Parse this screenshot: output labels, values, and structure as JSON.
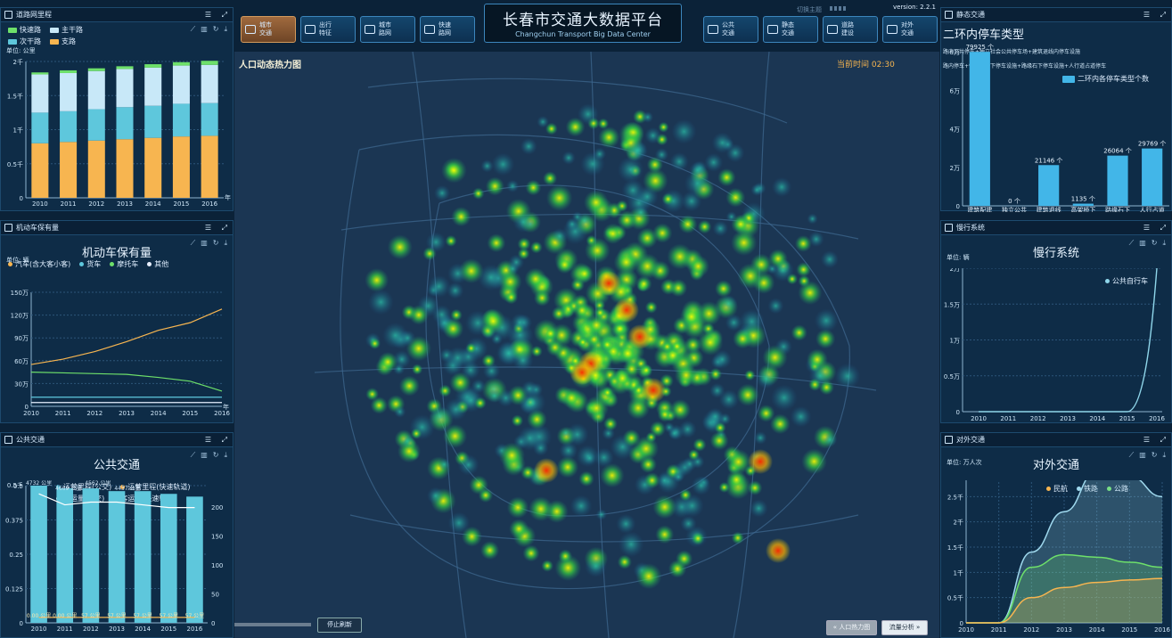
{
  "header": {
    "title": "长春市交通大数据平台",
    "subtitle": "Changchun Transport Big Data Center",
    "version": "version: 2.2.1",
    "theme_switch": "切换主题",
    "nav_left": [
      {
        "label1": "城市",
        "label2": "交通",
        "icon": "city-icon"
      },
      {
        "label1": "出行",
        "label2": "特征",
        "icon": "chart-icon"
      },
      {
        "label1": "城市",
        "label2": "路网",
        "icon": "road-icon"
      },
      {
        "label1": "快速",
        "label2": "路网",
        "icon": "car-icon"
      }
    ],
    "nav_right": [
      {
        "label1": "公共",
        "label2": "交通",
        "icon": "bus-icon"
      },
      {
        "label1": "静态",
        "label2": "交通",
        "icon": "map-icon"
      },
      {
        "label1": "道路",
        "label2": "建设",
        "icon": "build-icon"
      },
      {
        "label1": "对外",
        "label2": "交通",
        "icon": "external-icon"
      }
    ]
  },
  "map": {
    "title": "人口动态热力图",
    "time_label": "当前时间 02:30",
    "stop_button": "停止刷新",
    "tab_heatmap": "« 人口热力图",
    "tab_flow": "流量分析 »"
  },
  "colors": {
    "accent": "#f7b550",
    "panel_bg": "#0e2c47",
    "border": "#1d4a6e",
    "active_nav": "#a06a3e"
  },
  "road_panel": {
    "header": "道路网里程",
    "unit": "单位: 公里",
    "legend": [
      {
        "name": "快速路",
        "color": "#6ee06a"
      },
      {
        "name": "主干路",
        "color": "#c8e8f8"
      },
      {
        "name": "次干路",
        "color": "#5ec7dc"
      },
      {
        "name": "支路",
        "color": "#f7b550"
      }
    ],
    "chart_data": {
      "type": "bar",
      "categories": [
        "2010",
        "2011",
        "2012",
        "2013",
        "2014",
        "2015",
        "2016"
      ],
      "series": [
        {
          "name": "支路",
          "values": [
            800,
            820,
            840,
            860,
            880,
            900,
            910
          ]
        },
        {
          "name": "次干路",
          "values": [
            450,
            450,
            460,
            470,
            470,
            480,
            480
          ]
        },
        {
          "name": "主干路",
          "values": [
            560,
            560,
            560,
            560,
            560,
            560,
            560
          ]
        },
        {
          "name": "快速路",
          "values": [
            30,
            40,
            40,
            40,
            50,
            50,
            60
          ]
        }
      ],
      "yticks": [
        "0",
        "0.5千",
        "1千",
        "1.5千",
        "2千"
      ],
      "ylim": [
        0,
        2000
      ],
      "x_unit": "年"
    }
  },
  "vehicle_panel": {
    "header": "机动车保有量",
    "title": "机动车保有量",
    "unit": "单位: 辆",
    "legend": [
      {
        "name": "汽车(含大客小客)",
        "color": "#f7b550"
      },
      {
        "name": "货车",
        "color": "#5ec7dc"
      },
      {
        "name": "摩托车",
        "color": "#6ee06a"
      },
      {
        "name": "其他",
        "color": "#e8f0ff"
      }
    ],
    "chart_data": {
      "type": "line",
      "x": [
        "2010",
        "2011",
        "2012",
        "2013",
        "2014",
        "2015",
        "2016"
      ],
      "series": [
        {
          "name": "汽车(含大客小客)",
          "values": [
            55,
            62,
            72,
            85,
            100,
            110,
            128
          ]
        },
        {
          "name": "货车",
          "values": [
            12,
            12,
            12,
            12,
            12,
            12,
            12
          ]
        },
        {
          "name": "摩托车",
          "values": [
            45,
            44,
            43,
            42,
            38,
            33,
            20
          ]
        },
        {
          "name": "其他",
          "values": [
            5,
            5,
            5,
            5,
            5,
            5,
            5
          ]
        }
      ],
      "yticks": [
        "0",
        "30万",
        "60万",
        "90万",
        "120万",
        "150万"
      ],
      "ylim": [
        0,
        150
      ],
      "x_unit": "年"
    }
  },
  "transit_panel": {
    "header": "公共交通",
    "title": "公共交通",
    "legend": [
      {
        "name": "运营里程(公交)",
        "color": "#5ec7dc"
      },
      {
        "name": "运营里程(快速轨道)",
        "color": "#f7b550"
      },
      {
        "name": "客运量(公交)",
        "color": "#ffffff"
      },
      {
        "name": "客运量(快速轨道)",
        "color": "#6ee06a"
      }
    ],
    "chart_data": {
      "type": "bar",
      "categories": [
        "2010",
        "2011",
        "2012",
        "2013",
        "2014",
        "2015",
        "2016"
      ],
      "bars": [
        0.5,
        0.49,
        0.49,
        0.48,
        0.48,
        0.47,
        0.46
      ],
      "bus_passenger_line": [
        0.47,
        0.43,
        0.44,
        0.44,
        0.43,
        0.42,
        0.42
      ],
      "rail_passenger_line": [
        0.02,
        0.02,
        0.02,
        0.02,
        0.02,
        0.02,
        0.02
      ],
      "top_labels": [
        "4732 公里",
        "4669 公里",
        "4562 公里",
        "4437 公里"
      ],
      "bottom_labels": [
        "0.00 公里",
        "0.00 公里",
        "57 公里",
        "57 公里",
        "57 公里",
        "57 公里",
        "57 公里"
      ],
      "yticks_left": [
        "0",
        "0.125",
        "0.25",
        "0.375",
        "0.5",
        "0.5千"
      ],
      "yticks_right": [
        "0",
        "50",
        "100",
        "150",
        "200"
      ],
      "ylim": [
        0,
        0.5
      ]
    }
  },
  "parking_panel": {
    "header": "静态交通",
    "title": "二环内停车类型",
    "desc1": "路内公共停车+独立社会公共停车场+建筑退线内停车设施",
    "desc2": "路内停车+快速路桥下停车设施+路缘石下停车设施+人行道占道停车",
    "legend": "二环内各停车类型个数",
    "chart_data": {
      "type": "bar",
      "categories": [
        "建筑配建",
        "独立公共",
        "建筑退线",
        "高架桥下",
        "路缘石下",
        "人行占道"
      ],
      "values": [
        79925,
        0,
        21146,
        1135,
        26064,
        29769
      ],
      "value_labels": [
        "79925 个",
        "0 个",
        "21146 个",
        "1135 个",
        "26064 个",
        "29769 个"
      ],
      "yticks": [
        "0",
        "2万",
        "4万",
        "6万",
        "8万"
      ],
      "ylim": [
        0,
        80000
      ]
    }
  },
  "slow_panel": {
    "header": "慢行系统",
    "title": "慢行系统",
    "unit": "单位: 辆",
    "legend": "公共自行车",
    "chart_data": {
      "type": "line",
      "x": [
        "2010",
        "2011",
        "2012",
        "2013",
        "2014",
        "2015",
        "2016"
      ],
      "series": [
        {
          "name": "公共自行车",
          "values": [
            0,
            0,
            0,
            0,
            0,
            0,
            20000
          ]
        }
      ],
      "yticks": [
        "0",
        "0.5万",
        "1万",
        "1.5万",
        "2万"
      ],
      "ylim": [
        0,
        20000
      ]
    }
  },
  "external_panel": {
    "header": "对外交通",
    "title": "对外交通",
    "unit": "单位: 万人次",
    "legend": [
      {
        "name": "民航",
        "color": "#f7b550"
      },
      {
        "name": "铁路",
        "color": "#9fd9ee"
      },
      {
        "name": "公路",
        "color": "#6ee06a"
      }
    ],
    "chart_data": {
      "type": "area",
      "x": [
        "2010",
        "2011",
        "2012",
        "2013",
        "2014",
        "2015",
        "2016"
      ],
      "series": [
        {
          "name": "民航",
          "values": [
            0,
            0,
            0.5,
            0.7,
            0.8,
            0.85,
            0.88
          ]
        },
        {
          "name": "铁路",
          "values": [
            0,
            0,
            1.4,
            2.2,
            3.0,
            2.9,
            2.5
          ]
        },
        {
          "name": "公路",
          "values": [
            0,
            0,
            1.1,
            1.35,
            1.3,
            1.2,
            1.1
          ]
        }
      ],
      "yticks": [
        "0",
        "0.5千",
        "1千",
        "1.5千",
        "2千",
        "2.5千",
        "3千"
      ],
      "ylim": [
        0,
        3
      ]
    }
  }
}
